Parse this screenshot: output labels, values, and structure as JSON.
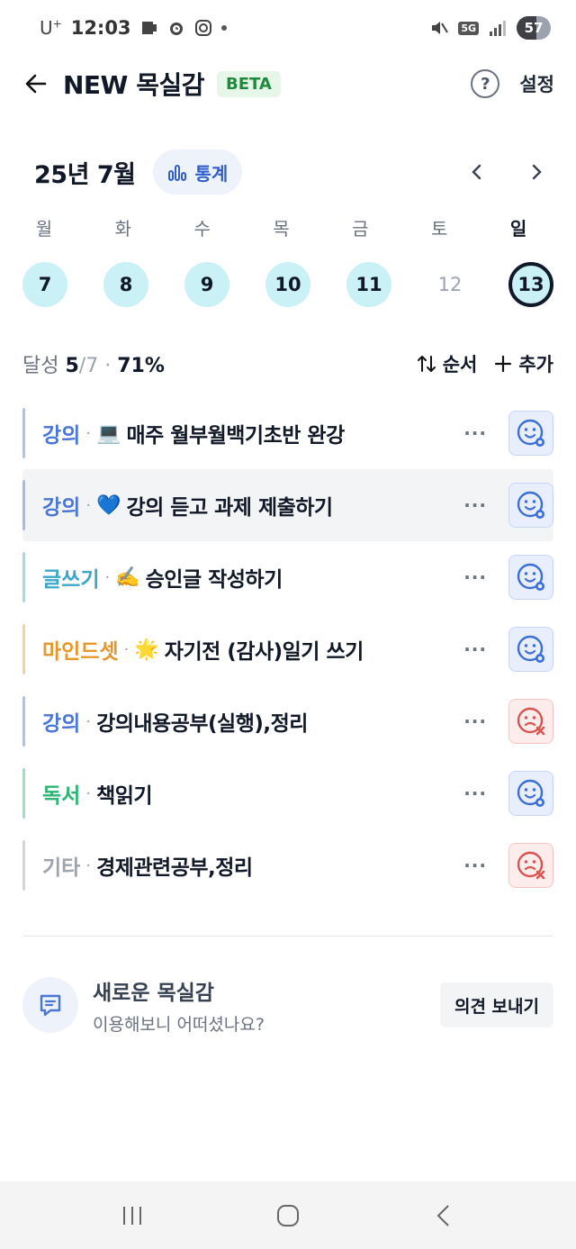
{
  "status_bar": {
    "carrier": "U",
    "carrier_sup": "+",
    "time": "12:03",
    "network": "5G",
    "battery": "57",
    "battery_level": 0.57
  },
  "header": {
    "title": "NEW 목실감",
    "badge": "BETA",
    "help_icon": "question-circle-icon",
    "settings_label": "설정"
  },
  "calendar": {
    "month_label": "25년 7월",
    "stats_label": "통계",
    "weekdays": [
      "월",
      "화",
      "수",
      "목",
      "금",
      "토",
      "일"
    ],
    "days": [
      "7",
      "8",
      "9",
      "10",
      "11",
      "12",
      "13"
    ]
  },
  "achievement": {
    "label": "달성",
    "done": "5",
    "total": "/7",
    "separator": "·",
    "percent": "71%",
    "order_label": "순서",
    "add_label": "추가"
  },
  "tasks": [
    {
      "category": "강의",
      "emoji": "💻",
      "title": "매주 월부월백기초반 완강",
      "status": "ok",
      "color": "#4a77d4"
    },
    {
      "category": "강의",
      "emoji": "💙",
      "title": "강의 듣고 과제 제출하기",
      "status": "ok",
      "color": "#4a77d4"
    },
    {
      "category": "글쓰기",
      "emoji": "✍️",
      "title": "승인글 작성하기",
      "status": "ok",
      "color": "#3aa8c9"
    },
    {
      "category": "마인드셋",
      "emoji": "🌟",
      "title": "자기전 (감사)일기 쓰기",
      "status": "ok",
      "color": "#e8982b"
    },
    {
      "category": "강의",
      "emoji": "",
      "title": "강의내용공부(실행),정리",
      "status": "fail",
      "color": "#4a77d4"
    },
    {
      "category": "독서",
      "emoji": "",
      "title": "책읽기",
      "status": "ok",
      "color": "#2bb673"
    },
    {
      "category": "기타",
      "emoji": "",
      "title": "경제관련공부,정리",
      "status": "fail",
      "color": "#9ca3af"
    }
  ],
  "task_more": "···",
  "feedback": {
    "title": "새로운 목실감",
    "subtitle": "이용해보니 어떠셨나요?",
    "button": "의견 보내기"
  }
}
